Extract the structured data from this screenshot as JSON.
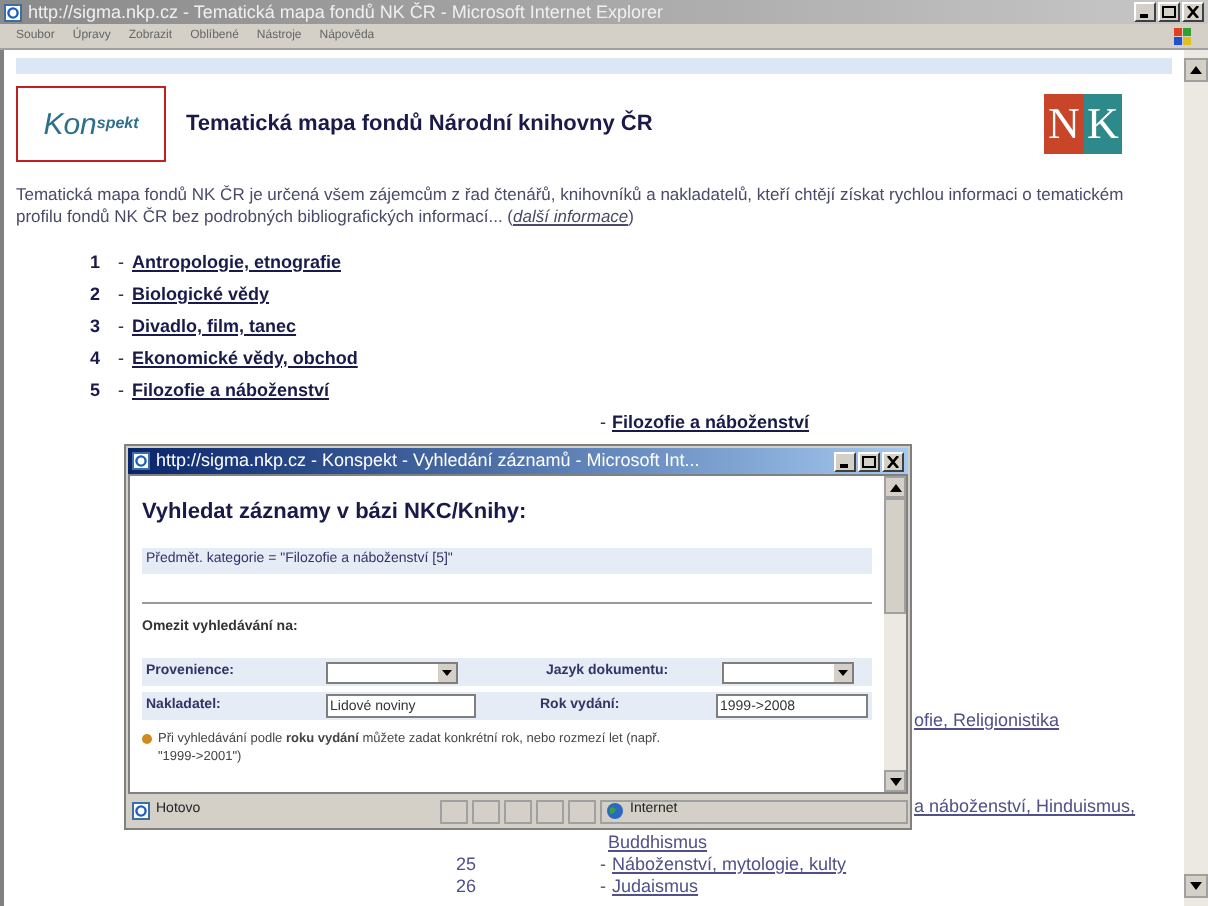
{
  "window": {
    "title": "http://sigma.nkp.cz - Tematická mapa fondů NK ČR - Microsoft Internet Explorer",
    "active": false
  },
  "menu": [
    "Soubor",
    "Úpravy",
    "Zobrazit",
    "Oblíbené",
    "Nástroje",
    "Nápověda"
  ],
  "header": {
    "logo_main": "Kon",
    "logo_small": "spekt",
    "title": "Tematická mapa fondů Národní knihovny ČR",
    "nk_left": "N",
    "nk_right": "K"
  },
  "intro": {
    "text": "Tematická mapa fondů NK ČR je určená všem zájemcům z řad čtenářů, knihovníků a nakladatelů, kteří chtějí získat rychlou informaci o tematickém profilu fondů NK ČR bez podrobných bibliografických informací... (",
    "link": "další informace",
    "after": ")"
  },
  "categories": [
    {
      "number": "1",
      "dash": "-",
      "label": "Antropologie, etnografie"
    },
    {
      "number": "2",
      "dash": "-",
      "label": "Biologické vědy"
    },
    {
      "number": "3",
      "dash": "-",
      "label": "Divadlo, film, tanec"
    },
    {
      "number": "4",
      "dash": "-",
      "label": "Ekonomické vědy, obchod"
    },
    {
      "number": "5",
      "dash": "-",
      "label": "Filozofie a náboženství"
    }
  ],
  "subheading": {
    "dash": "-",
    "label": "Filozofie a náboženství"
  },
  "subcategories": [
    {
      "label": "ofie, Religionistika",
      "kind": "fragment_high"
    },
    {
      "label": "a náboženství, Hinduismus,",
      "kind": "fragment_low"
    },
    {
      "label": "Buddhismus",
      "kind": "continuation"
    },
    {
      "number": "25",
      "dash": "-",
      "label": "Náboženství, mytologie, kulty",
      "kind": "item"
    },
    {
      "number": "26",
      "dash": "-",
      "label": "Judaismus",
      "kind": "item"
    }
  ],
  "popup": {
    "title": "http://sigma.nkp.cz - Konspekt - Vyhledání záznamů - Microsoft Int...",
    "active": true,
    "heading": "Vyhledat záznamy v bázi NKC/Knihy:",
    "criterion": "Předmět. kategorie =  \"Filozofie a náboženství [5]\"",
    "limit_heading": "Omezit vyhledávání na:",
    "fields": [
      [
        {
          "label": "Provenience:",
          "kind": "select"
        },
        {
          "label": "Jazyk dokumentu:",
          "kind": "select"
        }
      ],
      [
        {
          "label": "Nakladatel:",
          "kind": "text",
          "value": "Lidové noviny"
        },
        {
          "label": "Rok vydání:",
          "kind": "text",
          "value": "1999->2008"
        }
      ]
    ],
    "note": "Při vyhledávání podle **roku vydání** můžete zadat konkrétní rok, nebo rozmezí let (např. \"1999->2001\")",
    "status": "Hotovo",
    "zone": "Internet"
  }
}
